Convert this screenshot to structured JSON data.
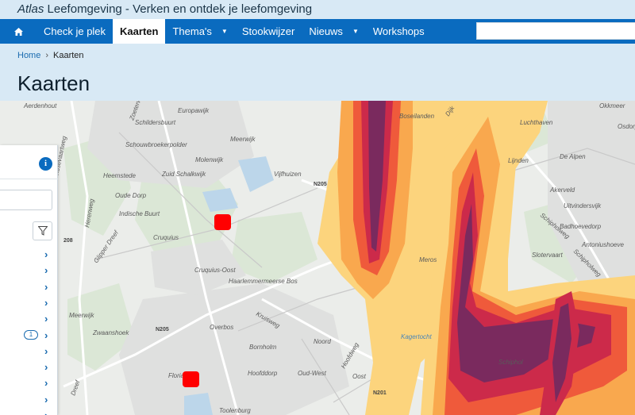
{
  "window": {
    "title_brand": "Atlas",
    "title_rest": " Leefomgeving - Verken en ontdek je leefomgeving"
  },
  "nav": {
    "home_icon": "home-icon",
    "items": [
      {
        "label": "Check je plek"
      },
      {
        "label": "Kaarten",
        "active": true
      },
      {
        "label": "Thema's",
        "dropdown": true
      },
      {
        "label": "Stookwijzer"
      },
      {
        "label": "Nieuws",
        "dropdown": true
      },
      {
        "label": "Workshops"
      }
    ],
    "search_value": ""
  },
  "breadcrumb": {
    "home": "Home",
    "separator": "›",
    "current": "Kaarten"
  },
  "page": {
    "title": "Kaarten"
  },
  "panel": {
    "info_icon": "info-icon",
    "filter_icon": "filter-icon",
    "chevron_icon": "chevron-right-icon",
    "layer_count": "1",
    "row_count": 11
  },
  "map": {
    "place_labels": [
      "Aerdenhout",
      "Europawijk",
      "Schildersbuurt",
      "Schouwbroekerpolder",
      "Meerwijk",
      "Molenwijk",
      "Zuid Schalkwijk",
      "Heemstede",
      "Oude Dorp",
      "Indische Buurt",
      "Vijfhuizen",
      "Cruquius",
      "Cruquius-Oost",
      "Haarlemmermeerse Bos",
      "Meerwijk",
      "Zwaanshoek",
      "Overbos",
      "Bornholm",
      "Noord",
      "Oud-West",
      "Oost",
      "Hoofddorp",
      "Floriande",
      "Toolenburg",
      "Boseilanden",
      "Luchthaven",
      "Lijnden",
      "De Alpen",
      "Akerveld",
      "Uitvindersvijk",
      "Badhoevedorp",
      "Antoniushoeve",
      "Slotervaart",
      "Okkmeer",
      "Osdorp",
      "Kagertocht",
      "Schiphol",
      "Leidsevaartweg",
      "Herenweg",
      "Glipper Dreef",
      "Dreef",
      "Kruisweg",
      "Hoofdweg",
      "Schipholweg",
      "Schipholweg",
      "Zoeterwoudsingel",
      "Dijk",
      "Meros"
    ],
    "road_labels": [
      "N205",
      "N205",
      "N201",
      "208"
    ],
    "noise_colors": [
      "#fcd47d",
      "#f9a84e",
      "#ef5a3b",
      "#cc2a4a",
      "#7a2a5e"
    ],
    "marker_color": "#ff0000"
  }
}
